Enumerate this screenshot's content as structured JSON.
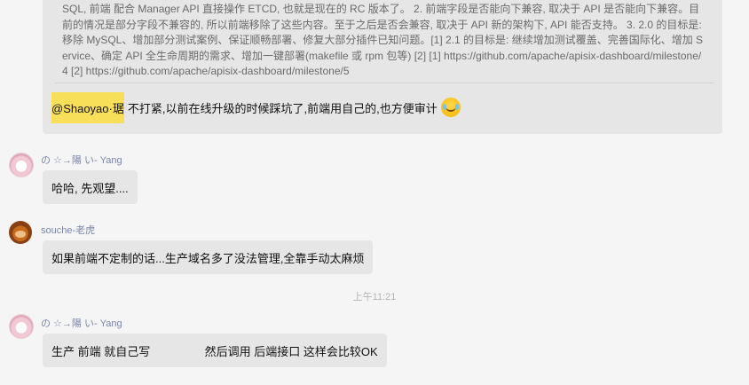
{
  "quoted_message": {
    "text": "SQL, 前端 配合 Manager API 直接操作 ETCD, 也就是现在的 RC 版本了。 2. 前端字段是否能向下兼容, 取决于 API 是否能向下兼容。目前的情况是部分字段不兼容的, 所以前端移除了这些内容。至于之后是否会兼容, 取决于 API 新的架构下, API 能否支持。 3. 2.0 的目标是: 移除 MySQL、增加部分测试案例、保证顺畅部署、修复大部分插件已知问题。[1] 2.1 的目标是: 继续增加测试覆盖、完善国际化、增加 Service、确定 API 全生命周期的需求、增加一键部署(makefile 或 rpm 包等) [2] [1] https://github.com/apache/apisix-dashboard/milestone/4 [2] https://github.com/apache/apisix-dashboard/milestone/5",
    "mention": "@Shaoyao·琚",
    "reply": "不打紧,以前在线升级的时候踩坑了,前端用自己的,也方便审计",
    "emoji": "laughing-tears"
  },
  "messages": [
    {
      "sender": "の ☆→陽 い- Yang",
      "text": "哈哈, 先观望...."
    },
    {
      "sender": "souche-老虎",
      "text": "如果前端不定制的话...生产域名多了没法管理,全靠手动太麻烦"
    },
    {
      "sender": "の ☆→陽 い- Yang",
      "text": "生产 前端 就自己写                 然后调用 后端接口 这样会比较OK"
    }
  ],
  "timestamp": "上午11:21",
  "colors": {
    "mention_highlight": "#f7df5a",
    "bubble": "#e6e6e6",
    "sender_name": "#7b86a8"
  }
}
